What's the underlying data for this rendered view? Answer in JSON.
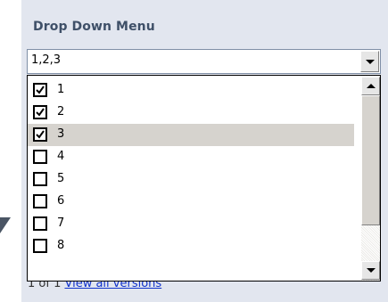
{
  "panel": {
    "label": "Drop Down Menu"
  },
  "select": {
    "value": "1,2,3"
  },
  "options": [
    {
      "label": "1",
      "checked": true,
      "highlighted": false
    },
    {
      "label": "2",
      "checked": true,
      "highlighted": false
    },
    {
      "label": "3",
      "checked": true,
      "highlighted": true
    },
    {
      "label": "4",
      "checked": false,
      "highlighted": false
    },
    {
      "label": "5",
      "checked": false,
      "highlighted": false
    },
    {
      "label": "6",
      "checked": false,
      "highlighted": false
    },
    {
      "label": "7",
      "checked": false,
      "highlighted": false
    },
    {
      "label": "8",
      "checked": false,
      "highlighted": false
    }
  ],
  "behind": {
    "version_prefix": "1 of 1",
    "version_link": "View all versions"
  },
  "colors": {
    "panel_bg": "#e2e6ef",
    "label_text": "#3f5068",
    "highlight": "#d6d3ce",
    "link": "#1133cc"
  },
  "icons": {
    "dropdown_arrow": "chevron-down-icon",
    "scroll_up": "scroll-up-arrow-icon",
    "scroll_down": "scroll-down-arrow-icon",
    "check": "checkmark-icon"
  }
}
